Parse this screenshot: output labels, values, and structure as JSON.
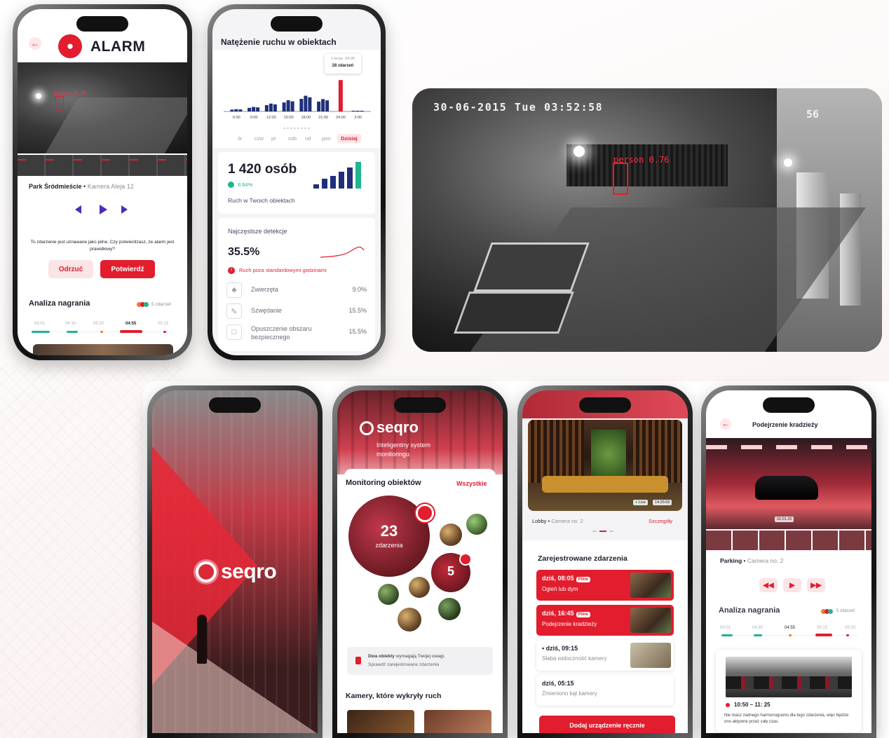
{
  "alarm": {
    "title": "ALARM",
    "detection_label": "person 0.76",
    "location": "Park Śródmieście",
    "camera": "Kamera Aleja 12",
    "question": "To zdarzenie jest uznawane jako pilne. Czy potwierdzasz, że alarm jest prawidłowy?",
    "reject_label": "Odrzuć",
    "confirm_label": "Potwierdź",
    "analysis_title": "Analiza nagrania",
    "events_count": "5 zdarzeń",
    "times": [
      "04:01",
      "04:30",
      "05:20",
      "04:55",
      "05:15"
    ]
  },
  "traffic": {
    "title": "Natężenie ruchu w obiektach",
    "tooltip_time": "1 teraz, 24:00",
    "tooltip_count": "28 zdarzeń",
    "hours": [
      "6:00",
      "9:00",
      "12:00",
      "15:00",
      "18:00",
      "21:00",
      "24:00",
      "3:00"
    ],
    "days": [
      "śr",
      "czw",
      "pt",
      "sob",
      "nd",
      "pon",
      "Dzisiaj"
    ],
    "people_count": "1 420 osób",
    "growth": "8.64%",
    "traffic_caption": "Ruch w Twoich obiektach",
    "frequent_title": "Najczęstsze detekcje",
    "frequent_percent": "35.5%",
    "off_hours_label": "Ruch poza standardowymi godzinami",
    "rows": [
      {
        "label": "Zwierzęta",
        "value": "9.0%"
      },
      {
        "label": "Szwędanie",
        "value": "15.5%"
      },
      {
        "label": "Opuszczenie obszaru bezpiecznego",
        "value": "15.5%"
      }
    ]
  },
  "chart_data": {
    "type": "bar",
    "categories": [
      "6:00",
      "9:00",
      "12:00",
      "15:00",
      "18:00",
      "21:00",
      "24:00",
      "3:00"
    ],
    "values": [
      2,
      4,
      7,
      10,
      14,
      11,
      28,
      0
    ],
    "title": "Natężenie ruchu w obiektach",
    "xlabel": "",
    "ylabel": "",
    "ylim": [
      0,
      30
    ]
  },
  "cctv": {
    "timestamp": "30-06-2015 Tue 03:52:58",
    "channel": "56",
    "detection_label": "person 0.76"
  },
  "splash": {
    "brand": "seqro"
  },
  "monitoring": {
    "brand": "seqro",
    "tagline": "Inteligentny system monitoringu",
    "section_title": "Monitoring obiektów",
    "all_link": "Wszystkie",
    "big_count": "23",
    "big_label": "zdarzenia",
    "small_count": "5",
    "notice_bold": "Dwa obiekty",
    "notice_rest": " wymagają Twojej uwagi.",
    "notice_sub": "Sprawdź zarejestrowane zdarzenia",
    "cameras_title": "Kamery, które wykryły ruch"
  },
  "lobby": {
    "live": "Live",
    "clock": "14:25:55",
    "name": "Lobby",
    "camera": "Camera no. 2",
    "details_link": "Szczegóły",
    "events_title": "Zarejestrowane zdarzenia",
    "events": [
      {
        "time": "dziś, 08:05",
        "badge": "Pilne",
        "desc": "Ogień lub dym"
      },
      {
        "time": "dziś, 16:45",
        "badge": "Pilne",
        "desc": "Podejrzenie kradzieży"
      },
      {
        "time": "dziś, 09:15",
        "desc": "Słaba widoczność kamery"
      },
      {
        "time": "dziś, 05:15",
        "desc": "Zmieniono kąt kamery"
      }
    ],
    "add_button": "Dodaj urządzenie ręcznie"
  },
  "theft": {
    "title": "Podejrzenie kradzieży",
    "stamp": "02.01.20",
    "location": "Parking",
    "camera": "Camera no. 2",
    "analysis_title": "Analiza nagrania",
    "events_count": "5 zdarzeń",
    "times": [
      "04:01",
      "04:30",
      "04:55",
      "05:15",
      "05:20"
    ],
    "range": "10:50 – 11: 25",
    "note": "Nie masz żadnego harmonogramu dla tego zdarzenia, więc będzie ono aktywne przez cały czas."
  },
  "colors": {
    "accent": "#e11d2e",
    "dark": "#1d1d2b",
    "green": "#1fb58f"
  }
}
